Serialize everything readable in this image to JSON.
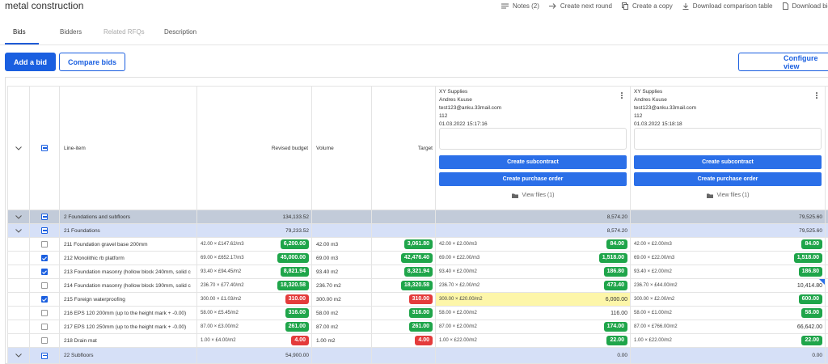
{
  "page": {
    "title": "metal construction"
  },
  "top_actions": [
    {
      "label": "Notes (2)",
      "icon": "notes-icon"
    },
    {
      "label": "Create next round",
      "icon": "arrow-right-icon"
    },
    {
      "label": "Create a copy",
      "icon": "copy-icon"
    },
    {
      "label": "Download comparison table",
      "icon": "download-icon"
    },
    {
      "label": "Download bid templ",
      "icon": "document-icon"
    }
  ],
  "tabs": [
    {
      "label": "Bids",
      "active": true
    },
    {
      "label": "Bidders",
      "active": false
    },
    {
      "label": "Related RFQs",
      "active": false,
      "muted": true
    },
    {
      "label": "Description",
      "active": false
    }
  ],
  "buttons": {
    "add_bid": "Add a bid",
    "compare_bids": "Compare bids",
    "configure_view": "Configure view"
  },
  "colors": {
    "primary": "#1a5fe0",
    "green": "#1fa54a",
    "red": "#e43b3b",
    "group_dark": "#c2cbd9",
    "group_light": "#d6e0f7",
    "highlight": "#fdf6a9"
  },
  "table": {
    "headers": {
      "line_item": "Line-item",
      "revised_budget": "Revised budget",
      "volume": "Volume",
      "target": "Target"
    },
    "bidders": [
      {
        "company": "XY Supplies",
        "contact": "Andres Kuuse",
        "email": "test123@anku.33mail.com",
        "phone": "112",
        "datetime": "01.03.2022 15:17:16",
        "create_subcontract": "Create subcontract",
        "create_purchase_order": "Create purchase order",
        "view_files": "View files (1)"
      },
      {
        "company": "XY Supplies",
        "contact": "Andres Kuuse",
        "email": "test123@anku.33mail.com",
        "phone": "112",
        "datetime": "01.03.2022 15:18:18",
        "create_subcontract": "Create subcontract",
        "create_purchase_order": "Create purchase order",
        "view_files": "View files (1)"
      }
    ],
    "groups": {
      "g2": {
        "label": "2 Foundations and subfloors",
        "revised": "134,133.52",
        "bid1": "8,574.20",
        "bid2": "79,525.60"
      },
      "g21": {
        "label": "21 Foundations",
        "revised": "79,233.52",
        "bid1": "8,574.20",
        "bid2": "79,525.60"
      },
      "g22": {
        "label": "22 Subfloors",
        "revised": "54,900.00",
        "bid1": "0.00",
        "bid2": "0.00"
      }
    },
    "rows": [
      {
        "checked": false,
        "item": "211 Foundation gravel base 200mm",
        "rev_calc": "42.00 × £147.62/m3",
        "rev_value": "6,200.00",
        "rev_style": "green",
        "volume": "42.00 m3",
        "target": "3,061.80",
        "target_style": "green",
        "b1_calc": "42.00 × £2.00/m3",
        "b1_value": "84.00",
        "b1_style": "green",
        "b2_calc": "42.00 × £2.00/m3",
        "b2_value": "84.00",
        "b2_style": "green"
      },
      {
        "checked": true,
        "item": "212 Monolithic rb platform",
        "rev_calc": "69.00 × £652.17/m3",
        "rev_value": "45,000.00",
        "rev_style": "green",
        "volume": "69.00 m3",
        "target": "42,476.40",
        "target_style": "green",
        "b1_calc": "69.00 × £22.00/m3",
        "b1_value": "1,518.00",
        "b1_style": "green",
        "b2_calc": "69.00 × £22.00/m3",
        "b2_value": "1,518.00",
        "b2_style": "green"
      },
      {
        "checked": true,
        "item": "213 Foundation masonry (hollow block 240mm, solid c",
        "rev_calc": "93.40 × £94.45/m2",
        "rev_value": "8,821.94",
        "rev_style": "green",
        "volume": "93.40 m2",
        "target": "8,321.94",
        "target_style": "green",
        "b1_calc": "93.40 × £2.00/m2",
        "b1_value": "186.80",
        "b1_style": "green",
        "b2_calc": "93.40 × £2.00/m2",
        "b2_value": "186.80",
        "b2_style": "green"
      },
      {
        "checked": false,
        "item": "214 Foundation masonry (hollow block 190mm, solid c",
        "rev_calc": "236.70 × £77.40/m2",
        "rev_value": "18,320.58",
        "rev_style": "green",
        "volume": "236.70 m2",
        "target": "18,320.58",
        "target_style": "green",
        "b1_calc": "236.70 × £2.00/m2",
        "b1_value": "473.40",
        "b1_style": "green",
        "b2_calc": "236.70 × £44.00/m2",
        "b2_value": "10,414.80",
        "b2_style": "plain",
        "b2_flag": true
      },
      {
        "checked": true,
        "item": "215 Foreign waterproofing",
        "rev_calc": "300.00 × £1.03/m2",
        "rev_value": "310.00",
        "rev_style": "red",
        "volume": "300.00 m2",
        "target": "310.00",
        "target_style": "red",
        "b1_calc": "300.00 × £20.00/m2",
        "b1_value": "6,000.00",
        "b1_style": "plain",
        "b1_yellow": true,
        "b2_calc": "300.00 × £2.00/m2",
        "b2_value": "600.00",
        "b2_style": "green"
      },
      {
        "checked": false,
        "item": "216 EPS 120 200mm (up to the height mark + -0.00)",
        "rev_calc": "58.00 × £5.45/m2",
        "rev_value": "316.00",
        "rev_style": "green",
        "volume": "58.00 m2",
        "target": "316.00",
        "target_style": "green",
        "b1_calc": "58.00 × £2.00/m2",
        "b1_value": "116.00",
        "b1_style": "plain",
        "b2_calc": "58.00 × £1.00/m2",
        "b2_value": "58.00",
        "b2_style": "green"
      },
      {
        "checked": false,
        "item": "217 EPS 120 250mm (up to the height mark + -0.00)",
        "rev_calc": "87.00 × £3.00/m2",
        "rev_value": "261.00",
        "rev_style": "green",
        "volume": "87.00 m2",
        "target": "261.00",
        "target_style": "green",
        "b1_calc": "87.00 × £2.00/m2",
        "b1_value": "174.00",
        "b1_style": "green",
        "b2_calc": "87.00 × £766.00/m2",
        "b2_value": "66,642.00",
        "b2_style": "plain"
      },
      {
        "checked": false,
        "item": "218 Drain mat",
        "rev_calc": "1.00 × £4.00/m2",
        "rev_value": "4.00",
        "rev_style": "red",
        "volume": "1.00 m2",
        "target": "4.00",
        "target_style": "red",
        "b1_calc": "1.00 × £22.00/m2",
        "b1_value": "22.00",
        "b1_style": "green",
        "b2_calc": "1.00 × £22.00/m2",
        "b2_value": "22.00",
        "b2_style": "green"
      }
    ]
  }
}
